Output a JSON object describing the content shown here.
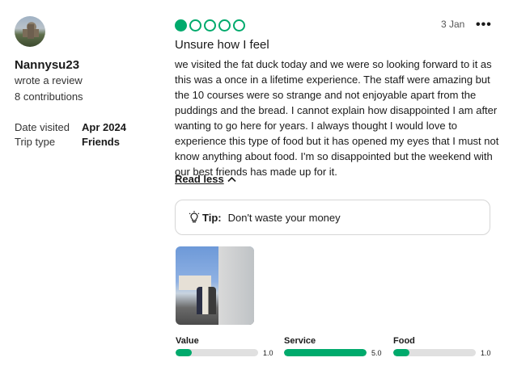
{
  "reviewer": {
    "username": "Nannysu23",
    "action": "wrote a review",
    "contributions": "8 contributions",
    "meta": [
      {
        "label": "Date visited",
        "value": "Apr 2024"
      },
      {
        "label": "Trip type",
        "value": "Friends"
      }
    ]
  },
  "review": {
    "rating": 1,
    "rating_max": 5,
    "date": "3 Jan",
    "more_label": "•••",
    "title": "Unsure how I feel",
    "body": "we visited the fat duck today and we were so looking forward to it as this was a once in a lifetime experience. The staff were amazing but the 10 courses were so strange and not enjoyable apart from the puddings and the bread. I cannot explain how disappointed I am after wanting to go here for years. I always thought I would love to experience this type of food but it has opened my eyes that I must not know anything about food. I'm so disappointed but the weekend with our best friends has made up for it.",
    "read_less": "Read less",
    "tip_label": "Tip:",
    "tip_text": "Don't waste your money"
  },
  "scores": [
    {
      "label": "Value",
      "value": 1.0,
      "display": "1.0"
    },
    {
      "label": "Service",
      "value": 5.0,
      "display": "5.0"
    },
    {
      "label": "Food",
      "value": 1.0,
      "display": "1.0"
    }
  ],
  "colors": {
    "accent": "#00aa6c",
    "track": "#e0e0e0"
  }
}
